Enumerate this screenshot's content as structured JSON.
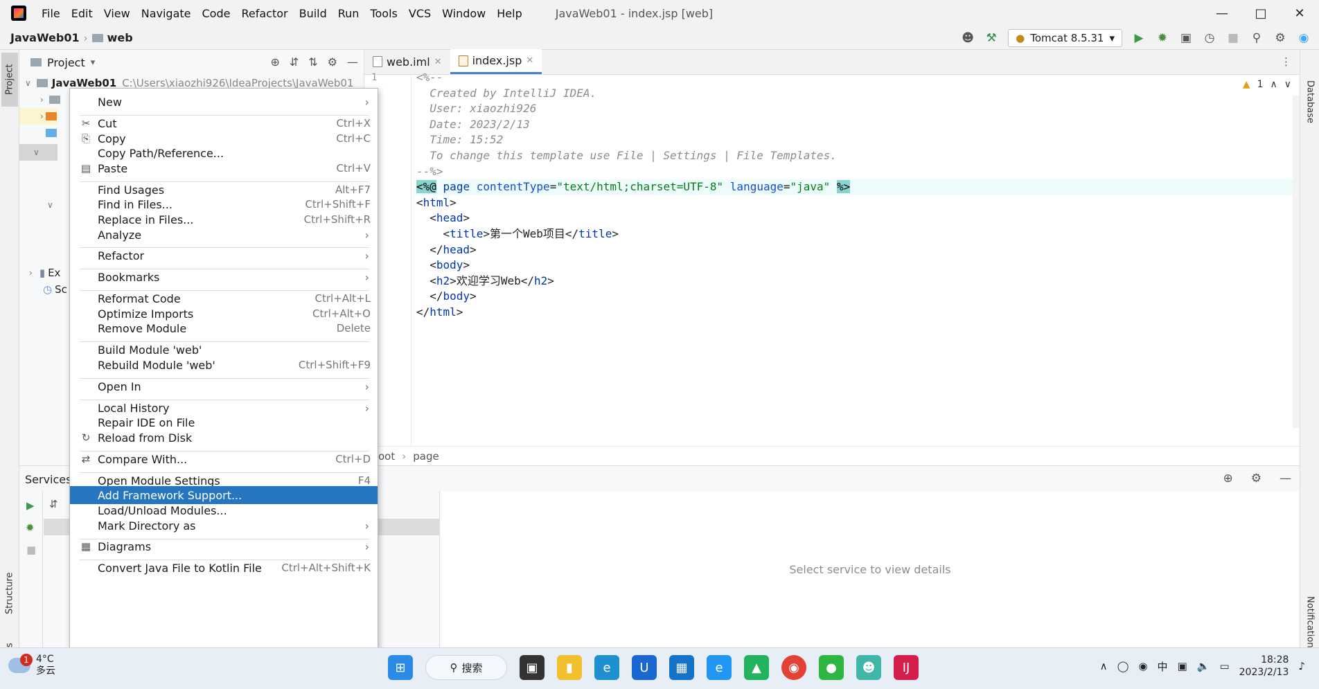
{
  "menubar": {
    "items": [
      "File",
      "Edit",
      "View",
      "Navigate",
      "Code",
      "Refactor",
      "Build",
      "Run",
      "Tools",
      "VCS",
      "Window",
      "Help"
    ],
    "window_title": "JavaWeb01 - index.jsp [web]"
  },
  "navbar": {
    "project": "JavaWeb01",
    "module": "web",
    "run_config": "Tomcat 8.5.31"
  },
  "left_stripe": {
    "project": "Project",
    "structure": "Structure",
    "bookmarks": "Bookmarks"
  },
  "right_stripe": {
    "database": "Database",
    "notifications": "Notifications"
  },
  "project_panel": {
    "title": "Project",
    "root_name": "JavaWeb01",
    "root_path": "C:\\Users\\xiaozhi926\\IdeaProjects\\JavaWeb01",
    "partial_items": [
      "Ex",
      "Sc"
    ]
  },
  "editor": {
    "tabs": [
      {
        "name": "web.iml",
        "active": false
      },
      {
        "name": "index.jsp",
        "active": true
      }
    ],
    "line_number_1": "1",
    "inspection_count": "1",
    "lines": {
      "l1": "<%--",
      "l2": "  Created by IntelliJ IDEA.",
      "l3": "  User: xiaozhi926",
      "l4": "  Date: 2023/2/13",
      "l5": "  Time: 15:52",
      "l6": "  To change this template use File | Settings | File Templates.",
      "l7": "--%>",
      "l8_open": "<%@",
      "l8_page": "page",
      "l8_ct_attr": "contentType",
      "l8_ct_val": "\"text/html;charset=UTF-8\"",
      "l8_lang_attr": "language",
      "l8_lang_val": "\"java\"",
      "l8_close": "%>",
      "l9": "html",
      "l10": "head",
      "l11_tag": "title",
      "l11_text": "第一个Web项目",
      "l12": "head",
      "l13": "body",
      "l14_tag": "h2",
      "l14_text": "欢迎学习Web",
      "l15": "body",
      "l16": "html"
    },
    "breadcrumbs": [
      "oot",
      "page"
    ]
  },
  "services": {
    "title": "Services",
    "empty_text": "Select service to view details"
  },
  "context_menu": {
    "items": [
      {
        "label": "New",
        "shortcut": "",
        "submenu": true
      },
      {
        "label": "Cut",
        "shortcut": "Ctrl+X",
        "icon": "scissors-icon"
      },
      {
        "label": "Copy",
        "shortcut": "Ctrl+C",
        "icon": "copy-icon"
      },
      {
        "label": "Copy Path/Reference...",
        "shortcut": ""
      },
      {
        "label": "Paste",
        "shortcut": "Ctrl+V",
        "icon": "paste-icon"
      },
      {
        "label": "Find Usages",
        "shortcut": "Alt+F7"
      },
      {
        "label": "Find in Files...",
        "shortcut": "Ctrl+Shift+F"
      },
      {
        "label": "Replace in Files...",
        "shortcut": "Ctrl+Shift+R"
      },
      {
        "label": "Analyze",
        "shortcut": "",
        "submenu": true
      },
      {
        "label": "Refactor",
        "shortcut": "",
        "submenu": true
      },
      {
        "label": "Bookmarks",
        "shortcut": "",
        "submenu": true
      },
      {
        "label": "Reformat Code",
        "shortcut": "Ctrl+Alt+L"
      },
      {
        "label": "Optimize Imports",
        "shortcut": "Ctrl+Alt+O"
      },
      {
        "label": "Remove Module",
        "shortcut": "Delete"
      },
      {
        "label": "Build Module 'web'",
        "shortcut": ""
      },
      {
        "label": "Rebuild Module 'web'",
        "shortcut": "Ctrl+Shift+F9"
      },
      {
        "label": "Open In",
        "shortcut": "",
        "submenu": true
      },
      {
        "label": "Local History",
        "shortcut": "",
        "submenu": true
      },
      {
        "label": "Repair IDE on File",
        "shortcut": ""
      },
      {
        "label": "Reload from Disk",
        "shortcut": "",
        "icon": "reload-icon"
      },
      {
        "label": "Compare With...",
        "shortcut": "Ctrl+D",
        "icon": "compare-icon"
      },
      {
        "label": "Open Module Settings",
        "shortcut": "F4"
      },
      {
        "label": "Add Framework Support...",
        "shortcut": "",
        "selected": true
      },
      {
        "label": "Load/Unload Modules...",
        "shortcut": ""
      },
      {
        "label": "Mark Directory as",
        "shortcut": "",
        "submenu": true
      },
      {
        "label": "Diagrams",
        "shortcut": "",
        "submenu": true,
        "icon": "diagram-icon"
      },
      {
        "label": "Convert Java File to Kotlin File",
        "shortcut": "Ctrl+Alt+Shift+K"
      }
    ]
  },
  "taskbar": {
    "weather_badge": "1",
    "temperature": "4°C",
    "condition": "多云",
    "search_label": "搜索",
    "ime": "中",
    "time": "18:28",
    "date": "2023/2/13"
  },
  "colors": {
    "selection": "#2675bf",
    "tag": "#0033b3",
    "string": "#067d17",
    "comment": "#8c8c8c"
  }
}
